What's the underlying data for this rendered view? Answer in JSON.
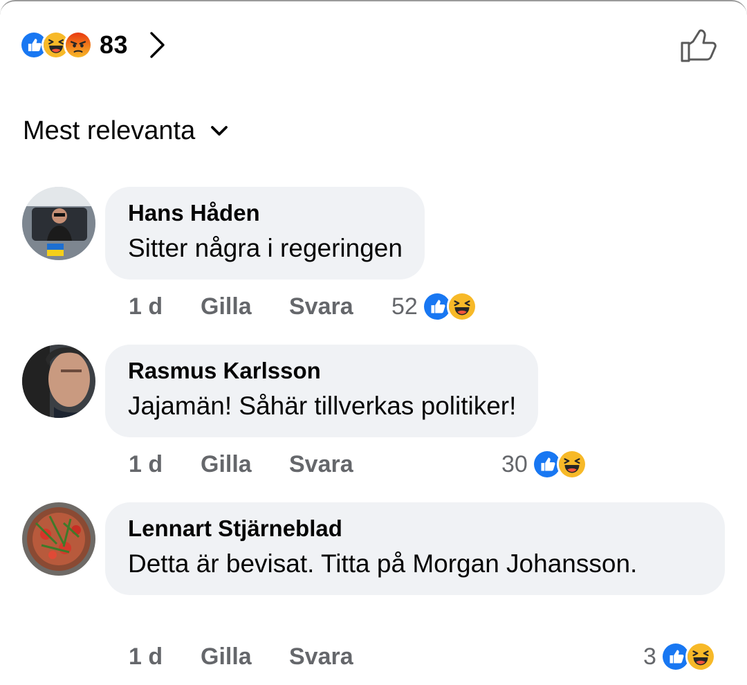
{
  "summary": {
    "reaction_icons": [
      "like-icon",
      "haha-icon",
      "angry-icon"
    ],
    "count": "83"
  },
  "sort": {
    "label": "Mest relevanta"
  },
  "comments": [
    {
      "author": "Hans Håden",
      "text": "Sitter några i regeringen",
      "time": "1 d",
      "like_label": "Gilla",
      "reply_label": "Svara",
      "reaction_count": "52",
      "reaction_icons": [
        "like-icon",
        "haha-icon"
      ]
    },
    {
      "author": "Rasmus Karlsson",
      "text": "Jajamän! Såhär tillverkas politiker!",
      "time": "1 d",
      "like_label": "Gilla",
      "reply_label": "Svara",
      "reaction_count": "30",
      "reaction_icons": [
        "like-icon",
        "haha-icon"
      ]
    },
    {
      "author": "Lennart Stjärneblad",
      "text": "Detta är bevisat. Titta på Morgan Johansson.",
      "time": "1 d",
      "like_label": "Gilla",
      "reply_label": "Svara",
      "reaction_count": "3",
      "reaction_icons": [
        "like-icon",
        "haha-icon"
      ]
    }
  ],
  "colors": {
    "like_blue": "#1877f2",
    "haha_yellow": "#f7b928",
    "angry_orange": "#e9710f",
    "bubble_bg": "#f0f2f5",
    "meta_gray": "#65676b"
  }
}
